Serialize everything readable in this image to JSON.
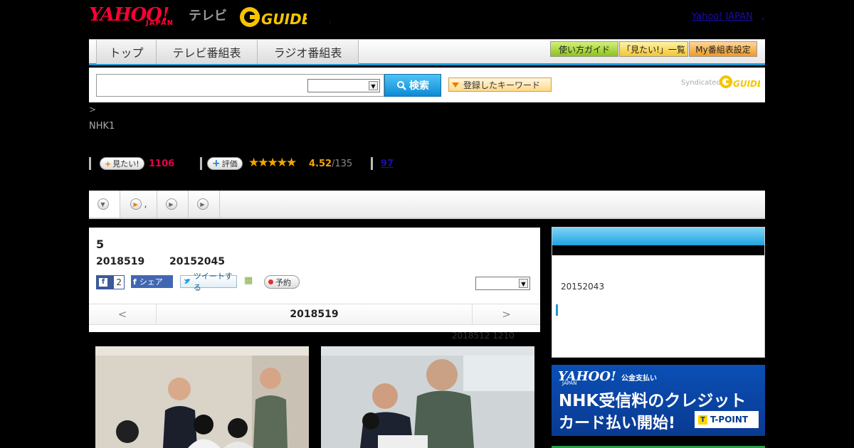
{
  "header": {
    "logo_yahoo": "YAHOO!",
    "logo_japan": "JAPAN",
    "logo_tv": "テレビ",
    "logo_gguide": "G GUIDE",
    "yahoo_link": "Yahoo! JAPAN",
    "dot": ","
  },
  "nav": {
    "tabs": [
      {
        "label": "トップ"
      },
      {
        "label": "テレビ番組表"
      },
      {
        "label": "ラジオ番組表"
      }
    ],
    "buttons": [
      {
        "label": "使い方ガイド"
      },
      {
        "label": "「見たい!」一覧"
      },
      {
        "label": "My番組表設定"
      }
    ]
  },
  "search": {
    "placeholder": "",
    "button_label": "検索",
    "keyword_button": "登録したキーワード",
    "syndicated": "Syndicated"
  },
  "breadcrumb": ">",
  "channel": "NHK1",
  "ratings": {
    "mitai_label": "見たい!",
    "mitai_count": "1106",
    "hyoka_label": "評価",
    "stars": "★★★★★",
    "score": "4.52",
    "score_total": "/135",
    "reviews": "97"
  },
  "tabs": [
    {
      "label": ""
    },
    {
      "label": ","
    },
    {
      "label": ""
    },
    {
      "label": ""
    }
  ],
  "episode": {
    "number": "5",
    "date": "2018519",
    "time": "20152045",
    "like_count": "2",
    "share_label": "シェア",
    "tweet_label": "ツイートする",
    "reserve_label": "予約"
  },
  "date_nav": {
    "prev": "<",
    "current": "2018519",
    "next": ">"
  },
  "update_note": "2018512  1210",
  "side": {
    "text": "20152043"
  },
  "ad": {
    "logo": "YAHOO!",
    "logo_jp": "JAPAN",
    "tag": "公金支払い",
    "line1": "NHK受信料のクレジット",
    "line2": "カード払い開始!",
    "tpoint": "T-POINT",
    "tpoint_mark": "T"
  },
  "colors": {
    "accent_blue": "#1e9ad6",
    "yahoo_red": "#ff0033",
    "mitai_pink": "#e4004f",
    "star_orange": "#f4a500"
  }
}
